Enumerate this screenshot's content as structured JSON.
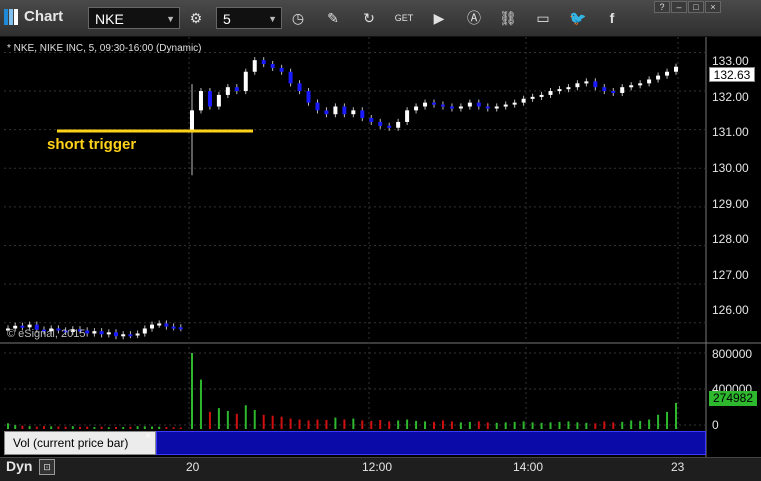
{
  "toolbar": {
    "app_title": "Chart",
    "symbol": "NKE",
    "interval": "5",
    "icons": [
      "gear-icon",
      "clock-icon",
      "pen-icon",
      "refresh-icon",
      "get-icon",
      "play-icon",
      "alert-icon",
      "link-icon",
      "chat-icon",
      "twitter-icon",
      "facebook-icon"
    ],
    "window_buttons": [
      "?",
      "–",
      "□",
      "×"
    ]
  },
  "chart_header": "* NKE, NIKE INC, 5, 09:30-16:00 (Dynamic)",
  "copyright": "© eSignal, 2015",
  "annotation": "short trigger",
  "price_axis": [
    "133.00",
    "132.00",
    "131.00",
    "130.00",
    "129.00",
    "128.00",
    "127.00",
    "126.00"
  ],
  "last_price": "132.63",
  "volume_axis": [
    "800000",
    "400000",
    "0"
  ],
  "last_volume": "274982",
  "volume_study_label": "Vol (current price bar)",
  "close_symbol": "×",
  "time_axis": [
    "20",
    "12:00",
    "14:00",
    "23"
  ],
  "bottom": {
    "mode": "Dyn",
    "icon": "fit-icon"
  },
  "colors": {
    "up_candle": "#ffffff",
    "down_candle": "#1a1aff",
    "trigger_line": "#ffd21a",
    "volume_up": "#2db82d",
    "volume_down": "#d01010",
    "background": "#000000"
  },
  "chart_data": {
    "type": "candlestick",
    "ylim": [
      125.5,
      133.4
    ],
    "prices": [
      125.85,
      125.92,
      125.88,
      125.95,
      125.82,
      125.78,
      125.85,
      125.8,
      125.76,
      125.83,
      125.8,
      125.72,
      125.78,
      125.7,
      125.75,
      125.65,
      125.7,
      125.68,
      125.72,
      125.85,
      125.95,
      125.98,
      125.9,
      125.88,
      125.86,
      131.5,
      132.0,
      131.6,
      131.9,
      132.1,
      132.0,
      132.5,
      132.8,
      132.7,
      132.6,
      132.5,
      132.2,
      132.0,
      131.7,
      131.5,
      131.4,
      131.6,
      131.4,
      131.5,
      131.3,
      131.2,
      131.1,
      131.05,
      131.2,
      131.5,
      131.6,
      131.7,
      131.65,
      131.6,
      131.55,
      131.6,
      131.7,
      131.6,
      131.55,
      131.6,
      131.65,
      131.7,
      131.8,
      131.85,
      131.9,
      132.0,
      132.05,
      132.1,
      132.2,
      132.25,
      132.1,
      132.0,
      131.95,
      132.1,
      132.15,
      132.2,
      132.3,
      132.4,
      132.5,
      132.63
    ],
    "volume": [
      60000,
      40000,
      35000,
      30000,
      25000,
      30000,
      28000,
      26000,
      24000,
      30000,
      22000,
      25000,
      20000,
      24000,
      18000,
      22000,
      20000,
      24000,
      30000,
      28000,
      26000,
      24000,
      20000,
      18000,
      15000,
      800000,
      520000,
      180000,
      220000,
      190000,
      160000,
      250000,
      200000,
      150000,
      140000,
      130000,
      110000,
      100000,
      90000,
      100000,
      95000,
      120000,
      100000,
      110000,
      90000,
      85000,
      95000,
      80000,
      90000,
      100000,
      85000,
      80000,
      75000,
      90000,
      80000,
      70000,
      75000,
      80000,
      70000,
      65000,
      70000,
      75000,
      80000,
      70000,
      65000,
      70000,
      75000,
      80000,
      70000,
      65000,
      60000,
      80000,
      70000,
      75000,
      90000,
      85000,
      100000,
      150000,
      180000,
      274982
    ]
  }
}
